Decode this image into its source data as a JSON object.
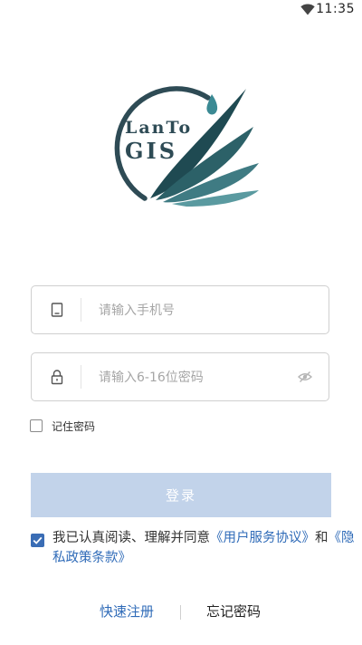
{
  "status_bar": {
    "time": "11:35",
    "wifi_icon": "wifi-icon"
  },
  "logo": {
    "line1": "LanTo",
    "line2": "GIS",
    "color": "#2e4b55",
    "accent": "#3b8a94"
  },
  "phone_field": {
    "placeholder": "请输入手机号",
    "value": "",
    "icon": "phone-icon"
  },
  "password_field": {
    "placeholder": "请输入6-16位密码",
    "value": "",
    "icon": "lock-icon",
    "toggle_icon": "eye-off-icon"
  },
  "remember": {
    "label": "记住密码",
    "checked": false
  },
  "login_button": {
    "label": "登录",
    "color": "#c2d3ea"
  },
  "agreement": {
    "checked": true,
    "prefix": "我已认真阅读、理解并同意",
    "user_agreement": "《用户服务协议》",
    "conjunction": "和",
    "privacy_policy": "《隐私政策条款》",
    "link_color": "#2f6bb8"
  },
  "bottom_links": {
    "register": "快速注册",
    "forgot": "忘记密码"
  }
}
